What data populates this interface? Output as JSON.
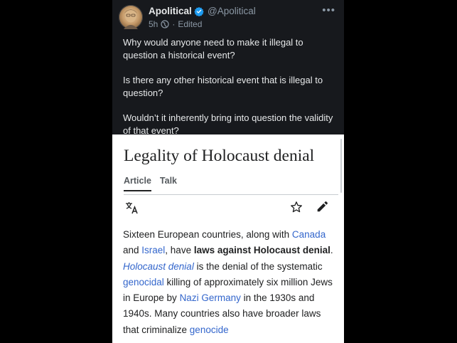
{
  "tweet": {
    "display_name": "Apolitical",
    "handle": "@Apolitical",
    "time": "5h",
    "separator": "·",
    "edited": "Edited",
    "more": "•••",
    "paragraphs": [
      "Why would anyone need to make it illegal to question a historical event?",
      "Is there any other historical event that is illegal to question?",
      "Wouldn’t it inherently bring into question the validity of that event?"
    ],
    "colors": {
      "background": "#17191d",
      "text": "#e7e9ea",
      "muted": "#8b98a5",
      "verified": "#1d9bf0"
    }
  },
  "wiki": {
    "title": "Legality of Holocaust denial",
    "tabs": {
      "article": "Article",
      "talk": "Talk"
    },
    "icons": {
      "language": "translate-icon",
      "watch": "star-icon",
      "edit": "pencil-icon"
    },
    "intro": {
      "t1": "Sixteen European countries, along with ",
      "canada": "Canada",
      "t2": " and ",
      "israel": "Israel",
      "t3": ", have ",
      "bold1": "laws against Holocaust denial",
      "t4": ". ",
      "holocaust_denial": "Holocaust denial",
      "t5": " is the denial of the systematic ",
      "genocidal": "genocidal",
      "t6": " killing of approximately six million Jews in Europe by ",
      "nazi_germany": "Nazi Germany",
      "t7": " in the 1930s and 1940s. Many countries also have broader laws that criminalize ",
      "genocide": "genocide"
    },
    "colors": {
      "link": "#3366cc",
      "text": "#202122"
    }
  }
}
